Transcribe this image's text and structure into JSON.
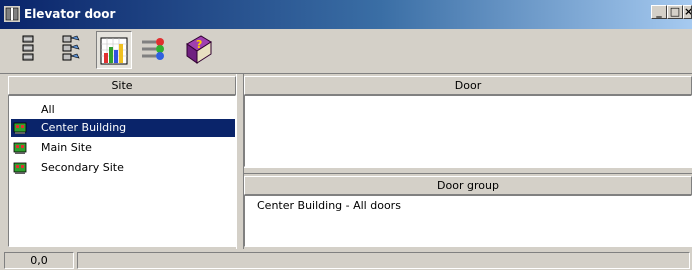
{
  "window": {
    "title": "Elevator door",
    "minimize": "_",
    "maximize": "□",
    "close": "×"
  },
  "toolbar": {
    "buttons": [
      {
        "icon": "list-large-icon"
      },
      {
        "icon": "list-details-icon"
      },
      {
        "icon": "bar-chart-icon",
        "pressed": true
      },
      {
        "icon": "legend-icon"
      },
      {
        "icon": "help-book-icon"
      }
    ]
  },
  "site_panel": {
    "header": "Site",
    "items": [
      {
        "label": "All",
        "icon": "none",
        "selected": false
      },
      {
        "label": "Center Building",
        "icon": "site-icon",
        "selected": true
      },
      {
        "label": "Main Site",
        "icon": "site-icon",
        "selected": false
      },
      {
        "label": "Secondary Site",
        "icon": "site-icon",
        "selected": false
      }
    ]
  },
  "door_panel": {
    "header": "Door",
    "items": []
  },
  "door_group_panel": {
    "header": "Door group",
    "items": [
      {
        "label": "Center Building - All doors"
      }
    ]
  },
  "statusbar": {
    "coords": "0,0",
    "message": ""
  },
  "colors": {
    "title_start": "#0a246a",
    "title_end": "#a6caf0",
    "selection": "#0a246a",
    "face": "#d4d0c8"
  }
}
